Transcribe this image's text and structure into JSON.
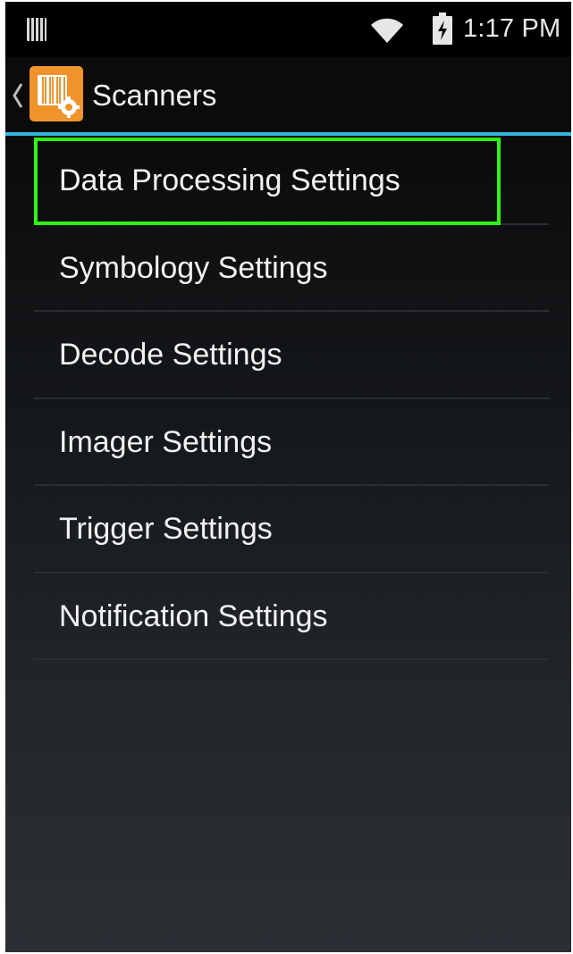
{
  "status_bar": {
    "time": "1:17 PM",
    "icons": [
      "notification-icon",
      "wifi-icon",
      "battery-charging-icon"
    ]
  },
  "action_bar": {
    "title": "Scanners",
    "icons": [
      "back-chevron-icon",
      "scanner-app-icon"
    ],
    "accent_color": "#33b5e5",
    "app_icon_color": "#f0932b"
  },
  "menu": {
    "items": [
      {
        "label": "Data Processing Settings",
        "highlighted": true
      },
      {
        "label": "Symbology Settings"
      },
      {
        "label": "Decode Settings"
      },
      {
        "label": "Imager Settings"
      },
      {
        "label": "Trigger Settings"
      },
      {
        "label": "Notification Settings"
      }
    ],
    "highlight_color": "#2cf516"
  }
}
